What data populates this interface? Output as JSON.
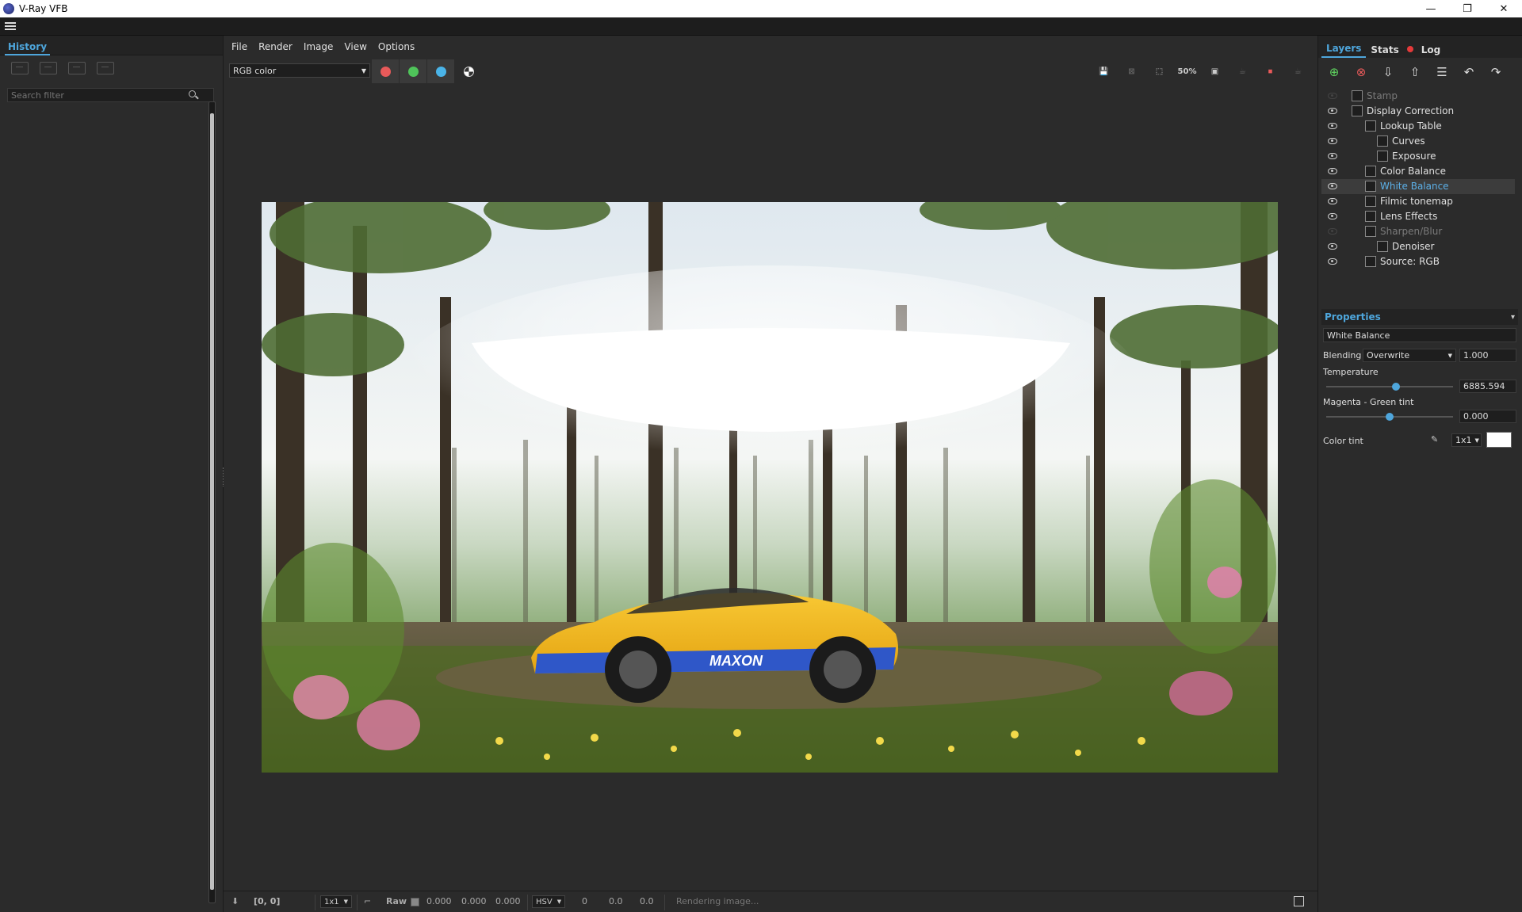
{
  "titlebar": {
    "title": "V-Ray VFB",
    "minimize": "—",
    "restore": "❐",
    "close": "✕"
  },
  "history": {
    "tab": "History",
    "search_placeholder": "Search filter"
  },
  "menu": [
    "File",
    "Render",
    "Image",
    "View",
    "Options"
  ],
  "channel": {
    "selected": "RGB color"
  },
  "channel_buttons": [
    {
      "name": "red-channel",
      "color": "#e85a5a"
    },
    {
      "name": "green-channel",
      "color": "#4fc45a"
    },
    {
      "name": "blue-channel",
      "color": "#4ab4e8"
    }
  ],
  "render_tools": {
    "zoom_label": "50%"
  },
  "layers_panel": {
    "tabs": [
      "Layers",
      "Stats",
      "Log"
    ],
    "layers": [
      {
        "label": "Stamp",
        "visible": false,
        "indent": 0,
        "icon": "stamp-icon"
      },
      {
        "label": "Display Correction",
        "visible": true,
        "indent": 0,
        "icon": "display-correction-icon"
      },
      {
        "label": "Lookup Table",
        "visible": true,
        "indent": 1,
        "icon": "lut-icon"
      },
      {
        "label": "Curves",
        "visible": true,
        "indent": 2,
        "icon": "curves-icon"
      },
      {
        "label": "Exposure",
        "visible": true,
        "indent": 2,
        "icon": "exposure-icon"
      },
      {
        "label": "Color Balance",
        "visible": true,
        "indent": 1,
        "icon": "color-balance-icon"
      },
      {
        "label": "White Balance",
        "visible": true,
        "indent": 1,
        "icon": "white-balance-icon",
        "selected": true
      },
      {
        "label": "Filmic tonemap",
        "visible": true,
        "indent": 1,
        "icon": "filmic-tonemap-icon"
      },
      {
        "label": "Lens Effects",
        "visible": true,
        "indent": 1,
        "icon": "lens-effects-icon"
      },
      {
        "label": "Sharpen/Blur",
        "visible": false,
        "indent": 1,
        "icon": "sharpen-blur-icon"
      },
      {
        "label": "Denoiser",
        "visible": true,
        "indent": 2,
        "icon": "denoiser-icon"
      },
      {
        "label": "Source: RGB",
        "visible": true,
        "indent": 1,
        "icon": "source-rgb-icon"
      }
    ]
  },
  "properties": {
    "title": "Properties",
    "layer_name": "White Balance",
    "blending_label": "Blending",
    "blending_mode": "Overwrite",
    "blending_value": "1.000",
    "temperature_label": "Temperature",
    "temperature_value": "6885.594",
    "temperature_level": 0.55,
    "tint_label": "Magenta - Green tint",
    "tint_value": "0.000",
    "tint_level": 0.5,
    "color_tint_label": "Color tint",
    "color_tint_mode": "1x1",
    "color_tint_swatch": "#ffffff"
  },
  "status": {
    "coords": "[0, 0]",
    "sample_mode": "1x1",
    "raw_label": "Raw",
    "r": "0.000",
    "g": "0.000",
    "b": "0.000",
    "color_space": "HSV",
    "h": "0",
    "s": "0.0",
    "v": "0.0",
    "message": "Rendering image..."
  }
}
